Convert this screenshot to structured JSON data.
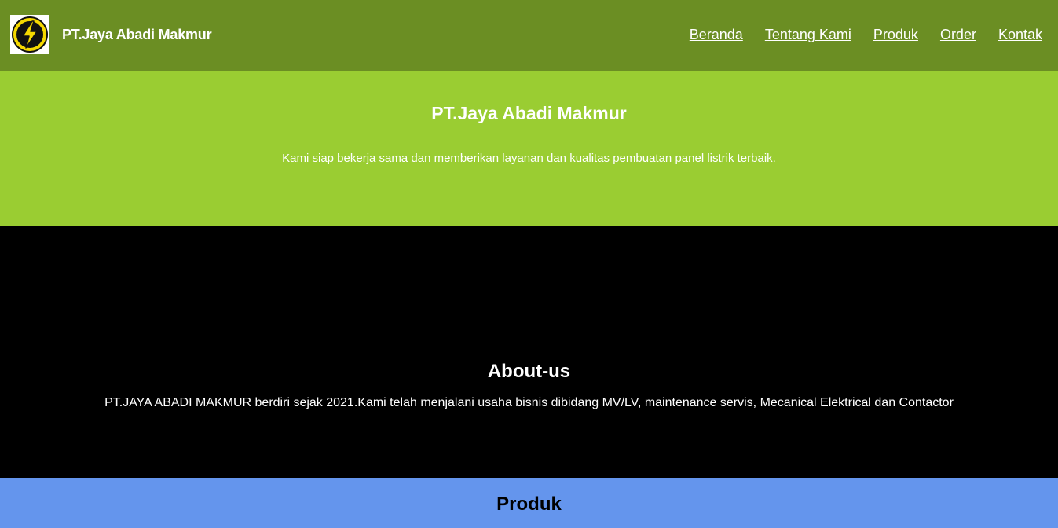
{
  "header": {
    "logo_icon": "lightning-bolt-icon",
    "brand": "PT.Jaya Abadi Makmur",
    "nav": [
      {
        "label": "Beranda"
      },
      {
        "label": "Tentang Kami"
      },
      {
        "label": "Produk"
      },
      {
        "label": "Order"
      },
      {
        "label": "Kontak"
      }
    ]
  },
  "hero": {
    "title": "PT.Jaya Abadi Makmur",
    "text": "Kami siap bekerja sama dan memberikan layanan dan kualitas pembuatan panel listrik terbaik."
  },
  "about": {
    "title": "About-us",
    "text": "PT.JAYA ABADI MAKMUR berdiri sejak 2021.Kami telah menjalani usaha bisnis dibidang MV/LV, maintenance servis, Mecanical Elektrical dan Contactor"
  },
  "produk": {
    "title": "Produk"
  },
  "colors": {
    "navbar": "#6b8e23",
    "hero": "#9acd32",
    "about": "#000000",
    "produk": "#6495ed",
    "logo_ring": "#f5d800"
  }
}
